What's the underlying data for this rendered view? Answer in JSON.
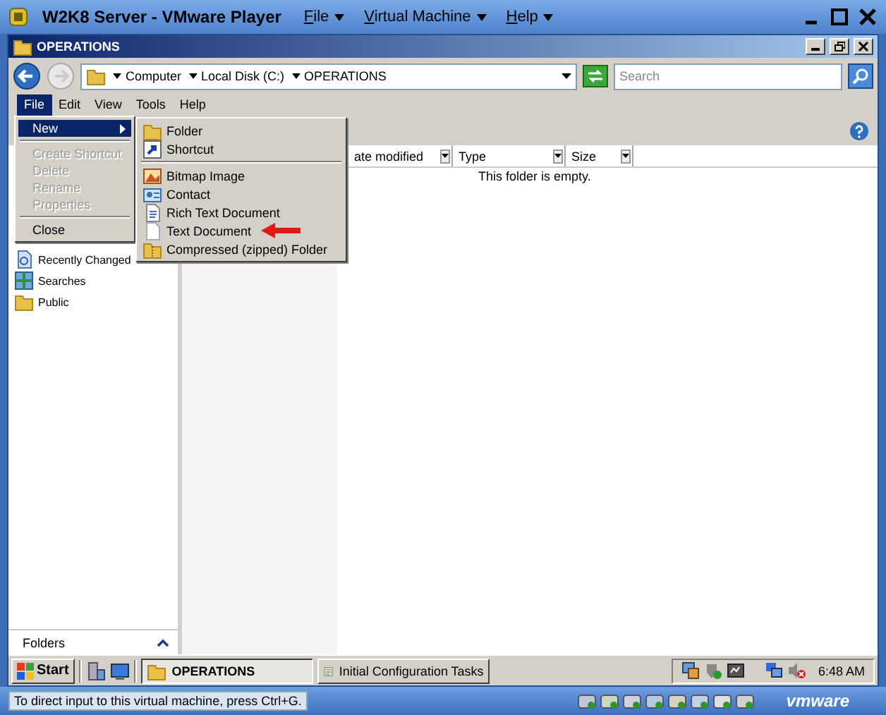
{
  "player": {
    "title": "W2K8 Server - VMware Player",
    "menus": [
      "File",
      "Virtual Machine",
      "Help"
    ]
  },
  "explorer": {
    "title": "OPERATIONS",
    "breadcrumb": [
      "Computer",
      "Local Disk (C:)",
      "OPERATIONS"
    ],
    "search": {
      "placeholder": "Search"
    },
    "menu_bar": [
      {
        "label": "File",
        "selected": true
      },
      {
        "label": "Edit",
        "selected": false
      },
      {
        "label": "View",
        "selected": false
      },
      {
        "label": "Tools",
        "selected": false
      },
      {
        "label": "Help",
        "selected": false
      }
    ],
    "columns": [
      "ate modified",
      "Type",
      "Size"
    ],
    "empty_message": "This folder is empty.",
    "nav_items": [
      {
        "label": "Recently Changed",
        "kind": "recent"
      },
      {
        "label": "Searches",
        "kind": "searches"
      },
      {
        "label": "Public",
        "kind": "folder"
      }
    ],
    "folders_label": "Folders"
  },
  "file_menu": [
    {
      "kind": "submenu",
      "label": "New",
      "selected": true,
      "disabled": false
    },
    {
      "kind": "separator"
    },
    {
      "kind": "item",
      "label": "Create Shortcut",
      "selected": false,
      "disabled": true
    },
    {
      "kind": "item",
      "label": "Delete",
      "selected": false,
      "disabled": true
    },
    {
      "kind": "item",
      "label": "Rename",
      "selected": false,
      "disabled": true
    },
    {
      "kind": "item",
      "label": "Properties",
      "selected": false,
      "disabled": true
    },
    {
      "kind": "separator"
    },
    {
      "kind": "item",
      "label": "Close",
      "selected": false,
      "disabled": false
    }
  ],
  "new_submenu": [
    {
      "kind": "folder",
      "label": "Folder",
      "annotated": false
    },
    {
      "kind": "shortcut",
      "label": "Shortcut",
      "annotated": false
    },
    {
      "kind": "separator"
    },
    {
      "kind": "bitmap",
      "label": "Bitmap Image",
      "annotated": false
    },
    {
      "kind": "contact",
      "label": "Contact",
      "annotated": false
    },
    {
      "kind": "rtf",
      "label": "Rich Text Document",
      "annotated": false
    },
    {
      "kind": "text",
      "label": "Text Document",
      "annotated": true
    },
    {
      "kind": "zip",
      "label": "Compressed (zipped) Folder",
      "annotated": false
    }
  ],
  "taskbar": {
    "start": "Start",
    "tasks": [
      {
        "label": "OPERATIONS",
        "kind": "folder",
        "selected": true
      },
      {
        "label": "Initial Configuration Tasks",
        "kind": "tasks",
        "selected": false
      }
    ],
    "clock": "6:48 AM"
  },
  "status_bar": {
    "message": "To direct input to this virtual machine, press Ctrl+G.",
    "logo": "vmware"
  }
}
